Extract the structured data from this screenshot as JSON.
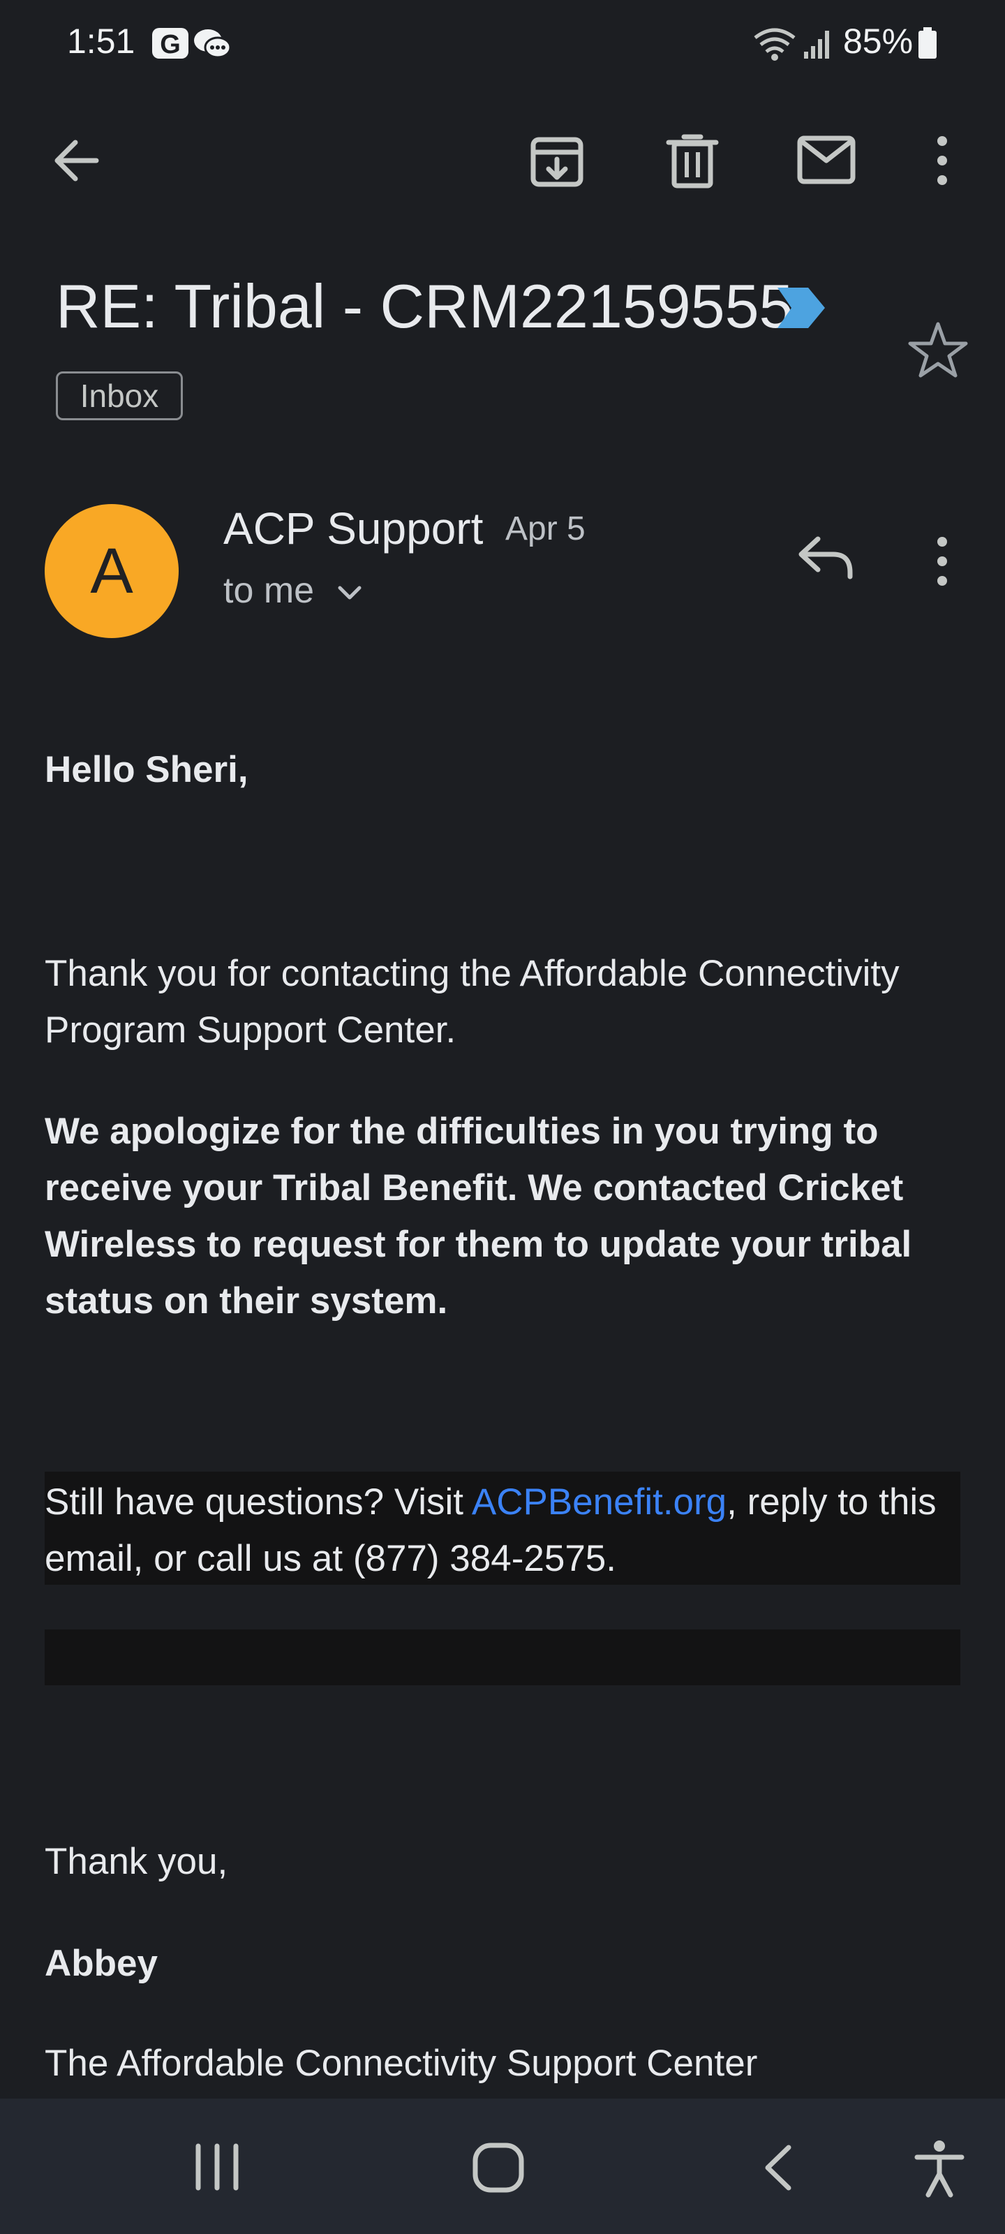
{
  "status_bar": {
    "time": "1:51",
    "battery": "85%"
  },
  "toolbar": {
    "icons": [
      "back-arrow-icon",
      "archive-icon",
      "delete-icon",
      "mark-unread-icon",
      "more-vert-icon"
    ]
  },
  "email": {
    "subject": "RE: Tribal - CRM22159555",
    "label": "Inbox",
    "sender": {
      "initial": "A",
      "name": "ACP Support",
      "date": "Apr 5",
      "recipient": "to me",
      "avatar_color": "#f9a825"
    },
    "body": {
      "greeting": "Hello Sheri,",
      "thanks_contact": "Thank you for contacting the Affordable Connectivity Program Support Center.",
      "apology": "We apologize for the difficulties in you trying to receive your Tribal Benefit. We contacted Cricket Wireless to request for them to update your tribal status on their system.",
      "questions_prefix": "Still have questions? Visit ",
      "link_text": "ACPBenefit.org",
      "questions_suffix": ", reply to this email, or call us at (877) 384-2575.",
      "closing": "Thank you,",
      "signature": "Abbey",
      "organization": "The Affordable Connectivity Support Center"
    }
  },
  "colors": {
    "background": "#1c1e22",
    "link": "#3b82f6",
    "important_marker": "#4da3e0",
    "nav_bar": "#242830"
  }
}
